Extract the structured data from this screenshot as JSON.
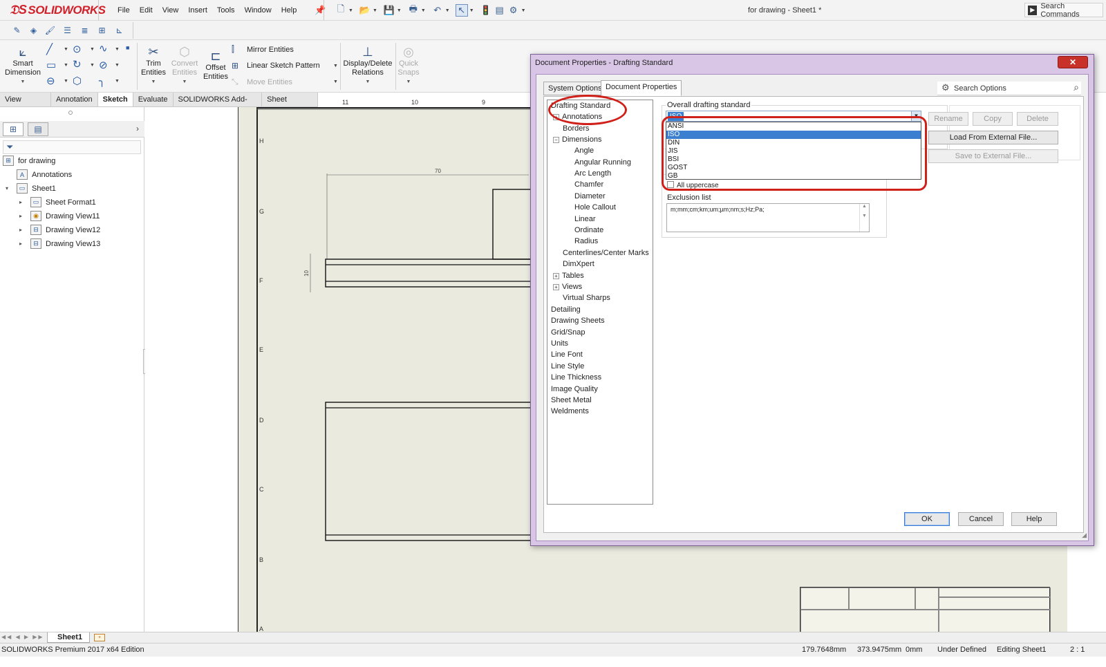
{
  "app": {
    "logo": "SOLIDWORKS",
    "menu": [
      "File",
      "Edit",
      "View",
      "Insert",
      "Tools",
      "Window",
      "Help"
    ],
    "document_title": "for drawing - Sheet1 *",
    "search_commands": "Search Commands"
  },
  "ribbon": {
    "smart_dimension": "Smart Dimension",
    "trim_entities": "Trim Entities",
    "convert_entities": "Convert Entities",
    "offset_entities": "Offset Entities",
    "mirror_entities": "Mirror Entities",
    "linear_sketch_pattern": "Linear Sketch Pattern",
    "move_entities": "Move Entities",
    "display_delete_relations": "Display/Delete Relations",
    "quick_snaps": "Quick Snaps"
  },
  "tabs": [
    "View Layout",
    "Annotation",
    "Sketch",
    "Evaluate",
    "SOLIDWORKS Add-Ins",
    "Sheet Format"
  ],
  "active_tab": "Sketch",
  "feature_tree": {
    "root": "for drawing",
    "items": [
      {
        "label": "Annotations",
        "icon": "annotation-icon"
      },
      {
        "label": "Sheet1",
        "icon": "sheet-icon"
      },
      {
        "label": "Sheet Format1",
        "icon": "sheet-format-icon"
      },
      {
        "label": "Drawing View11",
        "icon": "drawing-view-icon"
      },
      {
        "label": "Drawing View12",
        "icon": "drawing-view-icon"
      },
      {
        "label": "Drawing View13",
        "icon": "drawing-view-icon"
      }
    ]
  },
  "drawing": {
    "row_labels": [
      "H",
      "G",
      "F",
      "E",
      "D",
      "C",
      "B",
      "A"
    ],
    "col_labels": [
      "11",
      "10",
      "9"
    ],
    "dimensions": [
      "70",
      "10"
    ]
  },
  "dialog": {
    "title": "Document Properties - Drafting Standard",
    "close": "✕",
    "tabs": [
      "System Options",
      "Document Properties"
    ],
    "search_placeholder": "Search Options",
    "tree": [
      {
        "label": "Drafting Standard",
        "level": 0
      },
      {
        "label": "Annotations",
        "level": 1,
        "expander": "+"
      },
      {
        "label": "Borders",
        "level": 1
      },
      {
        "label": "Dimensions",
        "level": 1,
        "expander": "−"
      },
      {
        "label": "Angle",
        "level": 2
      },
      {
        "label": "Angular Running",
        "level": 2
      },
      {
        "label": "Arc Length",
        "level": 2
      },
      {
        "label": "Chamfer",
        "level": 2
      },
      {
        "label": "Diameter",
        "level": 2
      },
      {
        "label": "Hole Callout",
        "level": 2
      },
      {
        "label": "Linear",
        "level": 2
      },
      {
        "label": "Ordinate",
        "level": 2
      },
      {
        "label": "Radius",
        "level": 2
      },
      {
        "label": "Centerlines/Center Marks",
        "level": 1
      },
      {
        "label": "DimXpert",
        "level": 1
      },
      {
        "label": "Tables",
        "level": 1,
        "expander": "+"
      },
      {
        "label": "Views",
        "level": 1,
        "expander": "+"
      },
      {
        "label": "Virtual Sharps",
        "level": 1
      },
      {
        "label": "Detailing",
        "level": 0
      },
      {
        "label": "Drawing Sheets",
        "level": 0
      },
      {
        "label": "Grid/Snap",
        "level": 0
      },
      {
        "label": "Units",
        "level": 0
      },
      {
        "label": "Line Font",
        "level": 0
      },
      {
        "label": "Line Style",
        "level": 0
      },
      {
        "label": "Line Thickness",
        "level": 0
      },
      {
        "label": "Image Quality",
        "level": 0
      },
      {
        "label": "Sheet Metal",
        "level": 0
      },
      {
        "label": "Weldments",
        "level": 0
      }
    ],
    "overall_label": "Overall drafting standard",
    "selected_standard": "ISO",
    "options": [
      "ANSI",
      "ISO",
      "DIN",
      "JIS",
      "BSI",
      "GOST",
      "GB"
    ],
    "highlighted_option": "ISO",
    "all_uppercase_label": "All uppercase",
    "exclusion_label": "Exclusion list",
    "exclusion_value": "m;mm;cm;km;um;µm;nm;s;Hz;Pa;",
    "buttons": {
      "rename": "Rename",
      "copy": "Copy",
      "delete": "Delete",
      "load": "Load From External File...",
      "save": "Save to External File...",
      "ok": "OK",
      "cancel": "Cancel",
      "help": "Help"
    }
  },
  "bottom": {
    "sheet_tab": "Sheet1",
    "edition": "SOLIDWORKS Premium 2017 x64 Edition",
    "x": "179.7648mm",
    "y": "373.9475mm",
    "z": "0mm",
    "state": "Under Defined",
    "editing": "Editing Sheet1",
    "scale": "2 : 1"
  },
  "colors": {
    "brand_red": "#d0201a",
    "selection_blue": "#3b7fd1",
    "dialog_frame": "#d9c5e6",
    "sheet_bg": "#eaeadf"
  }
}
